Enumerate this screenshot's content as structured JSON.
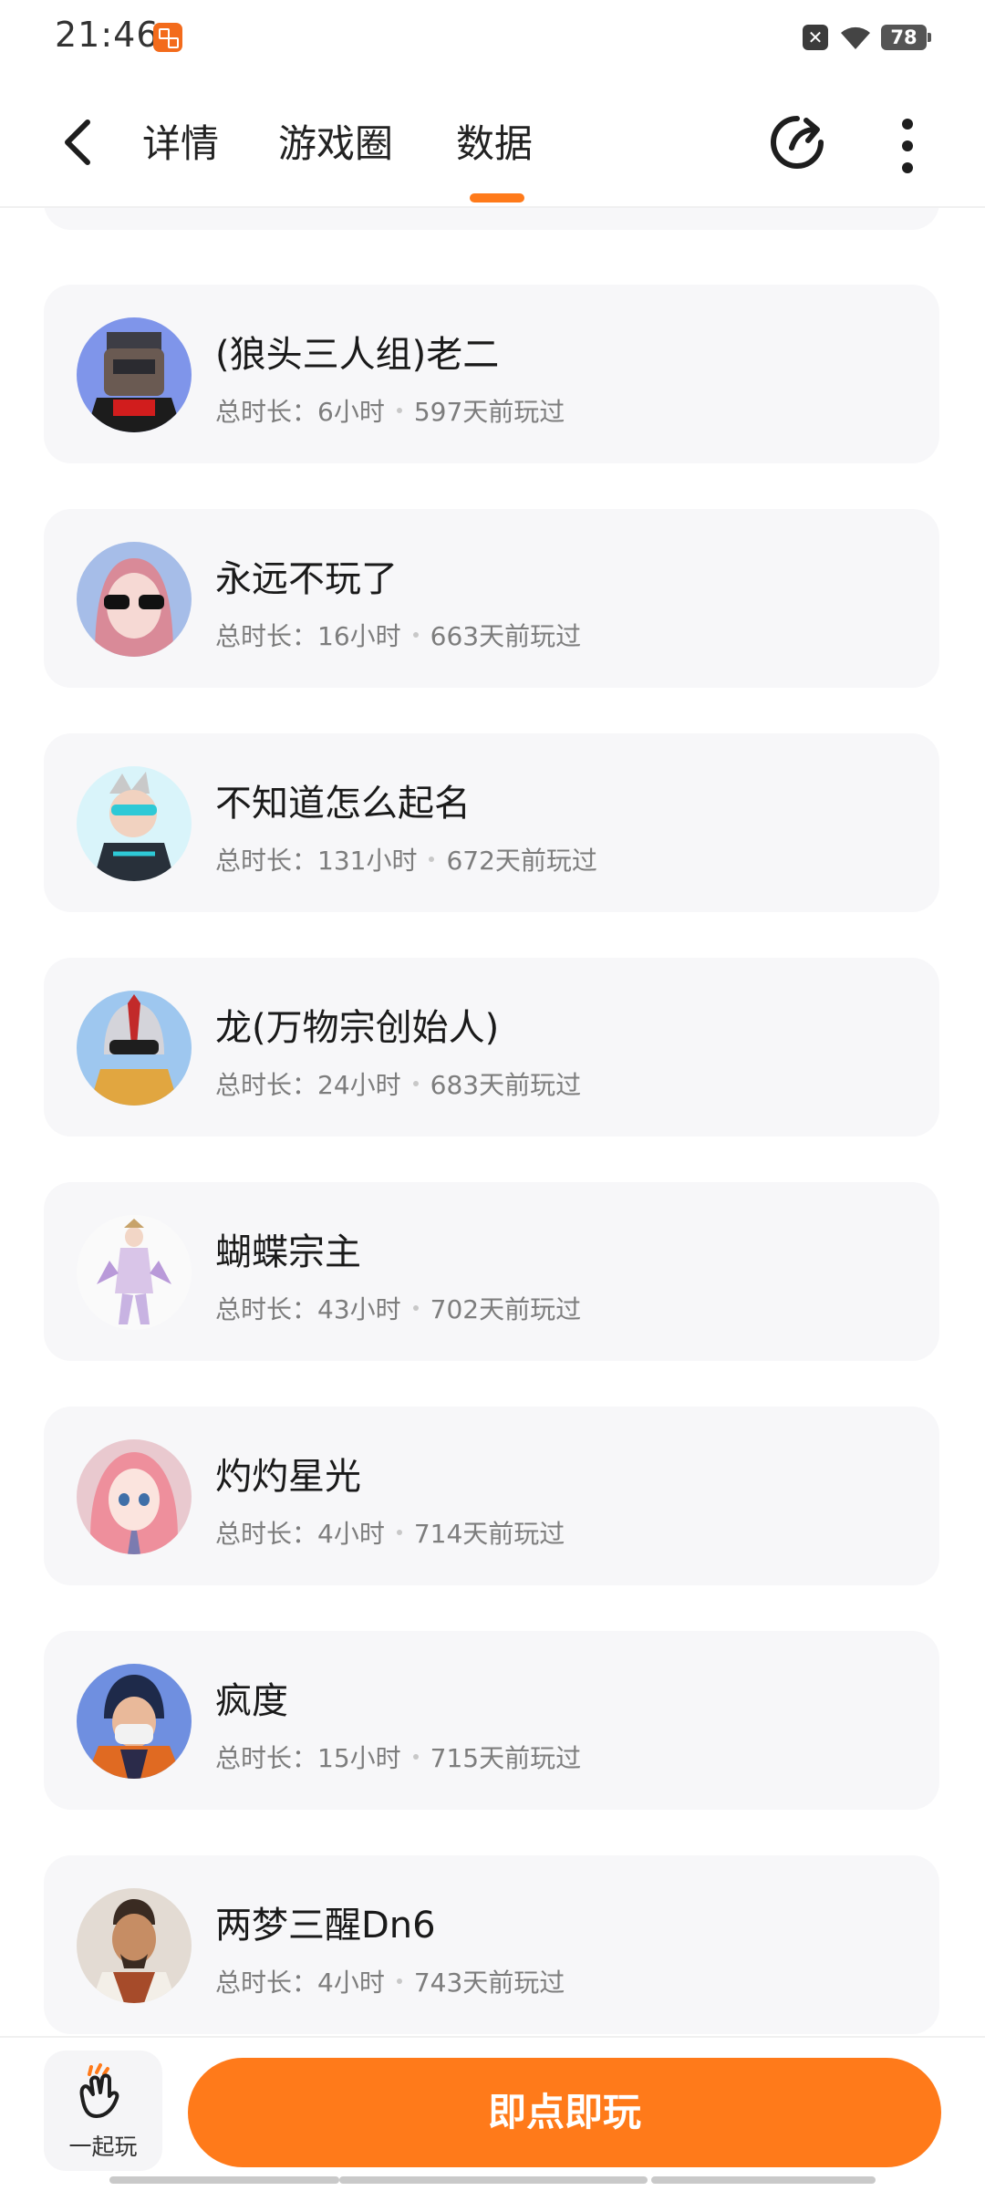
{
  "status_bar": {
    "time": "21:46",
    "battery": "78"
  },
  "nav": {
    "tabs": [
      {
        "label": "详情"
      },
      {
        "label": "游戏圈"
      },
      {
        "label": "数据",
        "active": true
      }
    ],
    "icons": [
      "back-arrow-icon",
      "share-icon",
      "more-vertical-icon"
    ],
    "accent_color": "#ff7a1a"
  },
  "players": [
    {
      "name": "(狼头三人组)老二",
      "duration_label": "总时长：",
      "duration": "6小时",
      "last_played": "597天前玩过"
    },
    {
      "name": "永远不玩了",
      "duration_label": "总时长：",
      "duration": "16小时",
      "last_played": "663天前玩过"
    },
    {
      "name": "不知道怎么起名",
      "duration_label": "总时长：",
      "duration": "131小时",
      "last_played": "672天前玩过"
    },
    {
      "name": "龙(万物宗创始人)",
      "duration_label": "总时长：",
      "duration": "24小时",
      "last_played": "683天前玩过"
    },
    {
      "name": "蝴蝶宗主",
      "duration_label": "总时长：",
      "duration": "43小时",
      "last_played": "702天前玩过"
    },
    {
      "name": "灼灼星光",
      "duration_label": "总时长：",
      "duration": "4小时",
      "last_played": "714天前玩过"
    },
    {
      "name": "疯度",
      "duration_label": "总时长：",
      "duration": "15小时",
      "last_played": "715天前玩过"
    },
    {
      "name": "两梦三醒Dn6",
      "duration_label": "总时长：",
      "duration": "4小时",
      "last_played": "743天前玩过"
    }
  ],
  "bottom_bar": {
    "together_label": "一起玩",
    "play_label": "即点即玩"
  }
}
